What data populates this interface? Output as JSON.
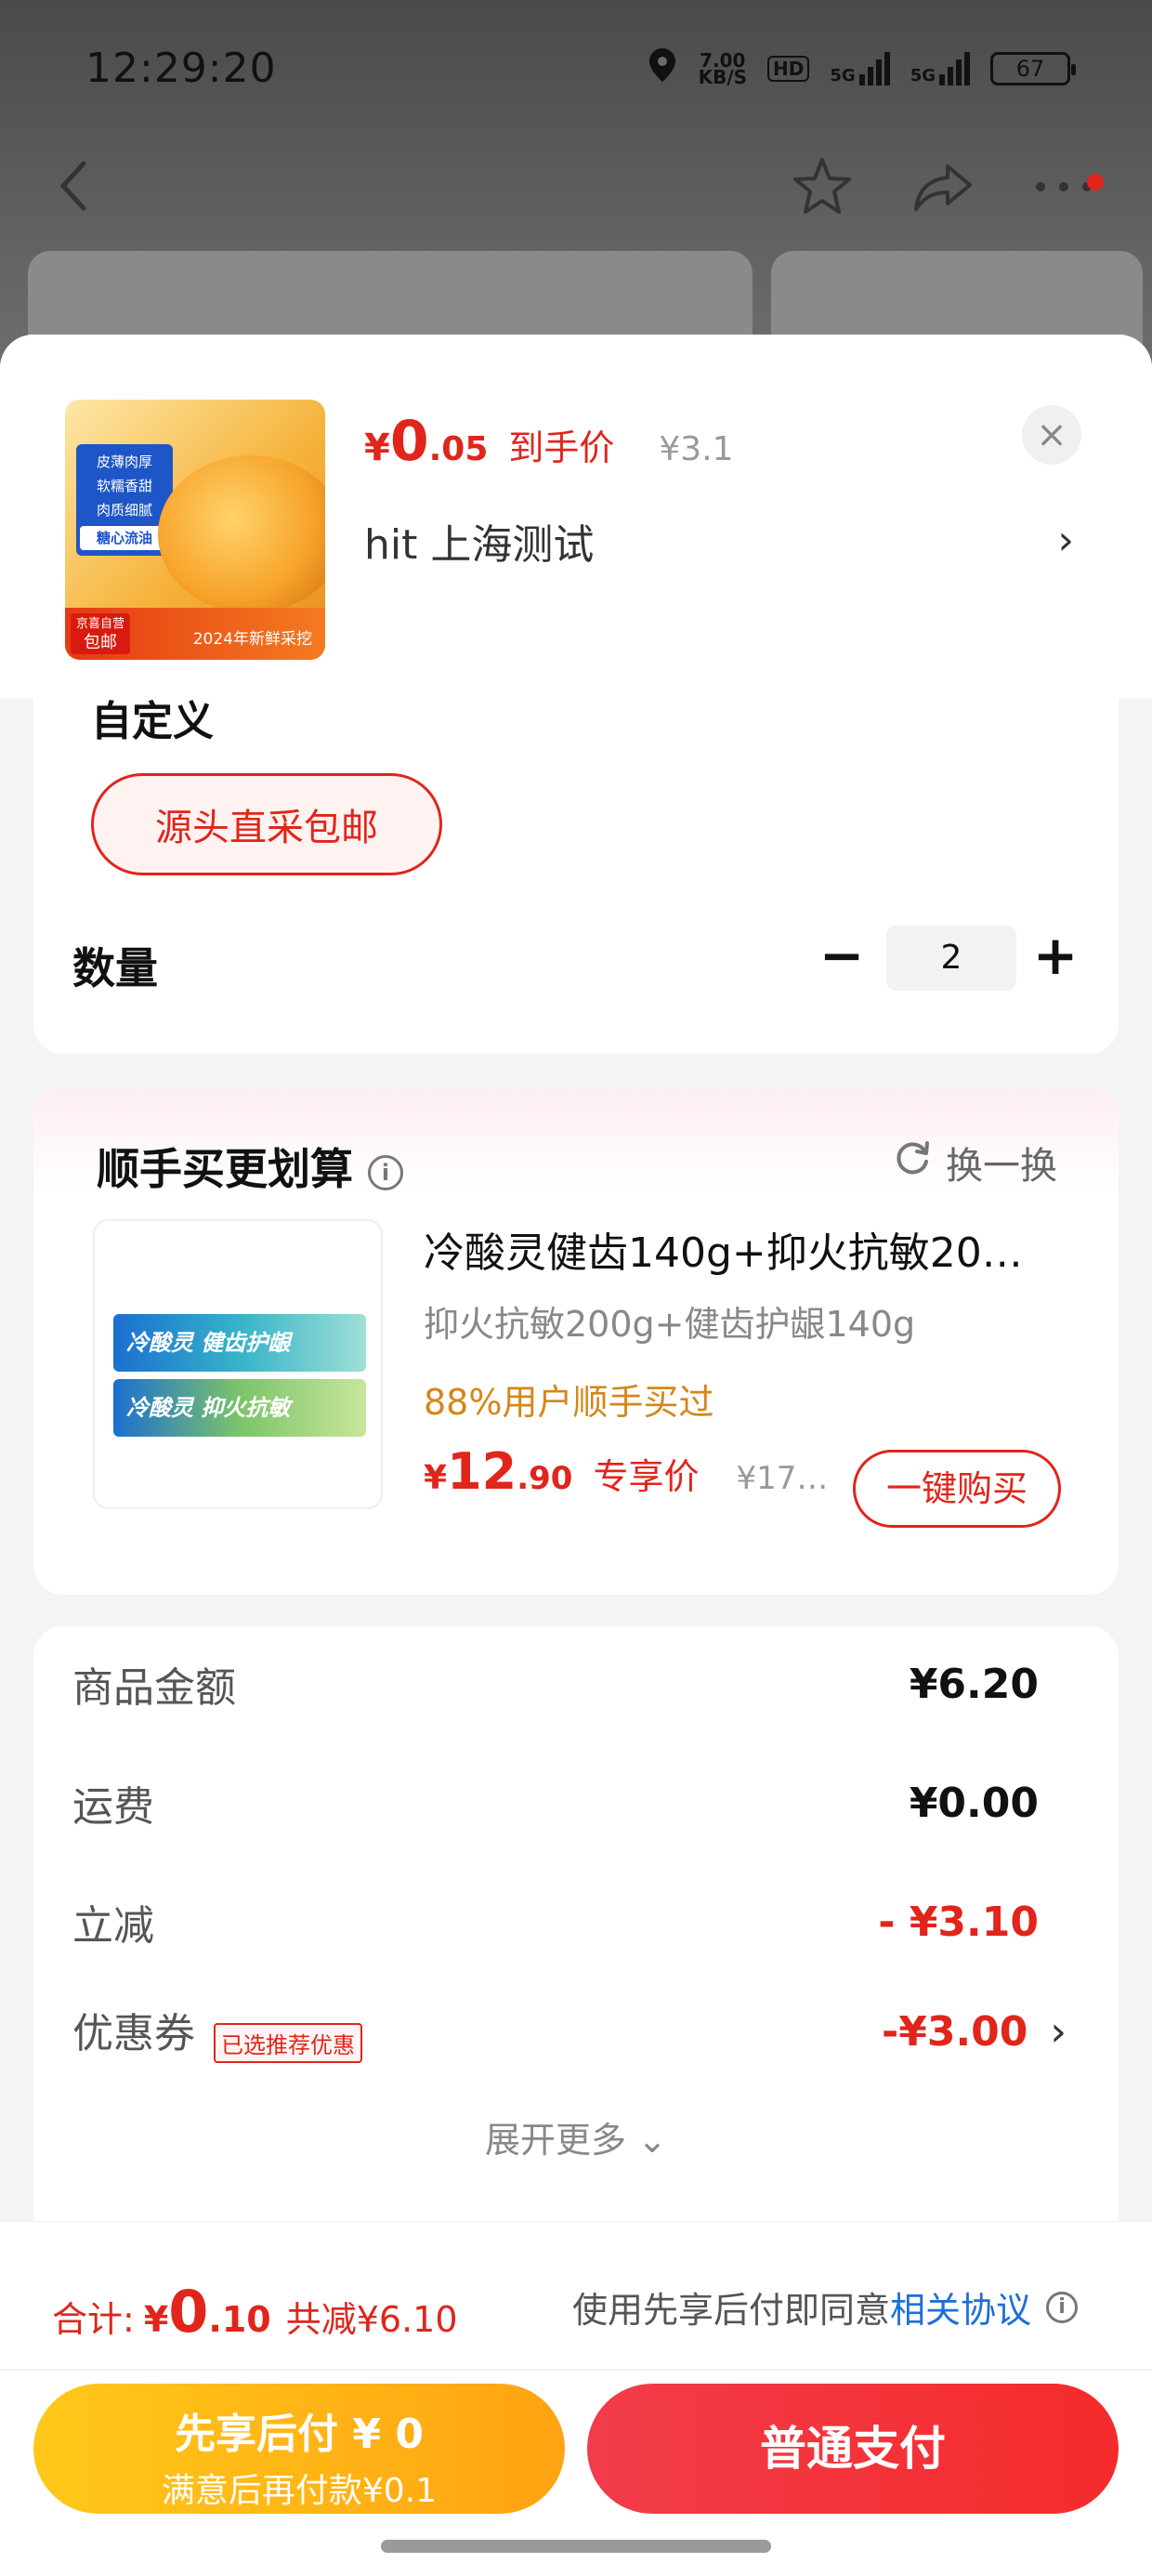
{
  "status_bar": {
    "time": "12:29:20",
    "net_speed": "7.00",
    "net_unit": "KB/S",
    "hd": "HD",
    "sig1": "5G",
    "sig2": "5G",
    "battery": "67"
  },
  "sheet": {
    "product": {
      "thumb_tags": [
        "皮薄肉厚",
        "软糯香甜",
        "肉质细腻",
        "糖心流油"
      ],
      "thumb_badge_line1": "京喜自营",
      "thumb_badge_line2": "包邮",
      "thumb_year": "2024年新鲜采挖",
      "price_currency": "¥",
      "price_int": "0",
      "price_dec": ".05",
      "price_label": "到手价",
      "orig_price": "¥3.1",
      "shop_line": "hit  上海测试",
      "chevron": "›",
      "close": "×"
    },
    "spec": {
      "title": "自定义",
      "chip": "源头直采包邮",
      "qty_label": "数量",
      "minus": "−",
      "qty_value": "2",
      "plus": "+"
    },
    "recommend": {
      "title": "顺手买更划算",
      "info": "i",
      "swap": "换一换",
      "paste1": "冷酸灵 健齿护龈",
      "paste2": "冷酸灵 抑火抗敏",
      "name": "冷酸灵健齿140g+抑火抗敏20…",
      "spec": "抑火抗敏200g+健齿护龈140g",
      "social": "88%用户顺手买过",
      "price_currency": "¥",
      "price_int": "12",
      "price_dec": ".90",
      "price_label": "专享价",
      "orig_price": "¥17…",
      "buy": "一键购买"
    },
    "summary": {
      "rows": [
        {
          "label": "商品金额",
          "value": "¥6.20"
        },
        {
          "label": "运费",
          "value": "¥0.00"
        },
        {
          "label": "立减",
          "value": "- ¥3.10"
        },
        {
          "label": "优惠券",
          "value": "-¥3.00"
        }
      ],
      "coupon_tag": "已选推荐优惠",
      "coupon_chevron": "›",
      "expand": "展开更多 ⌄"
    }
  },
  "bottom": {
    "total_label": "合计:",
    "total_currency": "¥",
    "total_int": "0",
    "total_dec": ".10",
    "total_reduce": "共减¥6.10",
    "agree_text": "使用先享后付即同意",
    "agree_link": "相关协议",
    "agree_info": "i",
    "pay_later_l1": "先享后付 ¥ 0",
    "pay_later_l2": "满意后再付款¥0.1",
    "pay_normal": "普通支付"
  },
  "colors": {
    "accent_red": "#e1251b",
    "pay_later_yellow": "#ffb414",
    "link_blue": "#1e6fd9",
    "social_orange": "#d4871a"
  }
}
